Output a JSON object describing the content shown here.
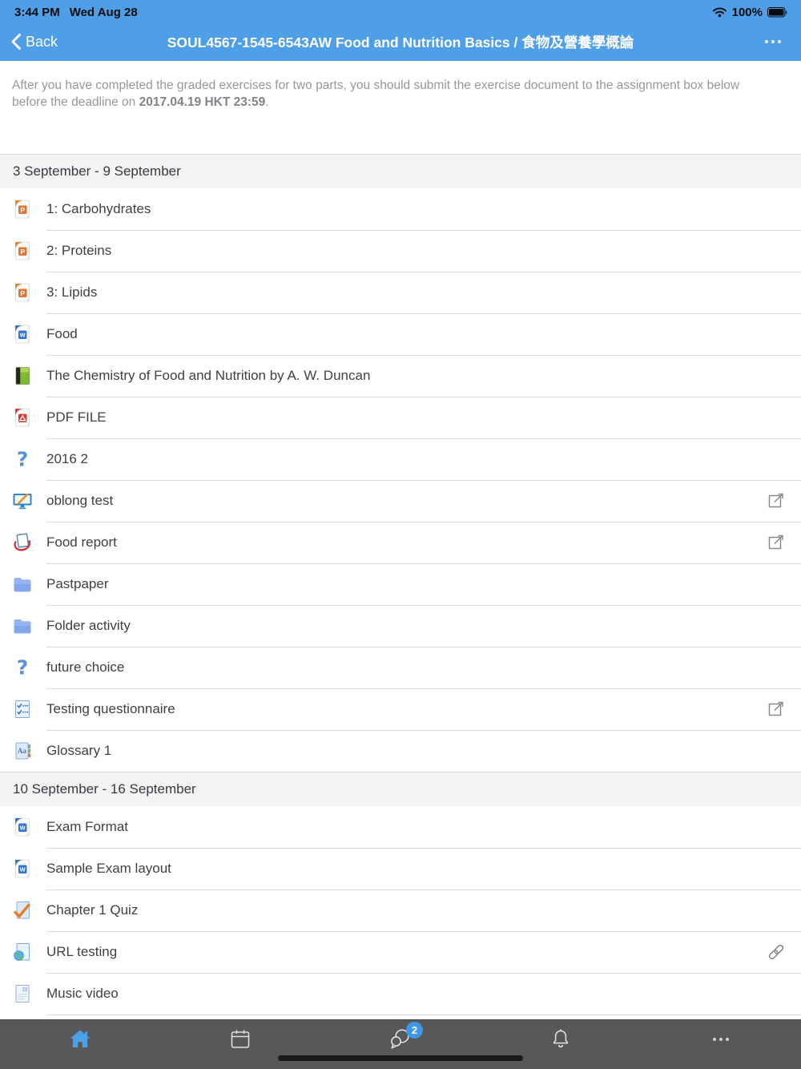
{
  "colors": {
    "header_blue": "#4F9FE8",
    "badge_blue": "#3E97E8",
    "home_tab_blue": "#4AA1E8",
    "tab_bar_gray": "#58585A"
  },
  "status_bar": {
    "time": "3:44 PM",
    "date": "Wed Aug 28",
    "battery_percent": "100%"
  },
  "nav_bar": {
    "back_label": "Back",
    "title": "SOUL4567-1545-6543AW Food and Nutrition Basics / 食物及營養學概論"
  },
  "course_summary": {
    "text_before": "After you have completed the graded exercises for two parts, you should submit the exercise document to the assignment box below before the deadline on ",
    "deadline": "2017.04.19 HKT 23:59",
    "text_after": "."
  },
  "sections": [
    {
      "header": "3 September - 9 September",
      "items": [
        {
          "icon": "powerpoint",
          "label": "1: Carbohydrates"
        },
        {
          "icon": "powerpoint",
          "label": "2: Proteins"
        },
        {
          "icon": "powerpoint",
          "label": "3: Lipids"
        },
        {
          "icon": "word",
          "label": "Food"
        },
        {
          "icon": "book",
          "label": "The Chemistry of Food and Nutrition by A. W. Duncan"
        },
        {
          "icon": "pdf",
          "label": "PDF FILE"
        },
        {
          "icon": "choice",
          "label": "2016 2"
        },
        {
          "icon": "assignment",
          "label": "oblong test",
          "trailing": "external-link"
        },
        {
          "icon": "turnitin",
          "label": "Food report",
          "trailing": "external-link"
        },
        {
          "icon": "folder",
          "label": "Pastpaper"
        },
        {
          "icon": "folder",
          "label": "Folder activity"
        },
        {
          "icon": "choice",
          "label": "future choice"
        },
        {
          "icon": "questionnaire",
          "label": "Testing questionnaire",
          "trailing": "external-link"
        },
        {
          "icon": "glossary",
          "label": "Glossary 1"
        }
      ]
    },
    {
      "header": "10 September - 16 September",
      "items": [
        {
          "icon": "word",
          "label": "Exam Format"
        },
        {
          "icon": "word",
          "label": "Sample Exam layout"
        },
        {
          "icon": "quiz",
          "label": "Chapter 1 Quiz"
        },
        {
          "icon": "url",
          "label": "URL testing",
          "trailing": "link"
        },
        {
          "icon": "page",
          "label": "Music video"
        }
      ]
    }
  ],
  "tab_bar": {
    "tabs": [
      {
        "name": "home",
        "active": true
      },
      {
        "name": "calendar"
      },
      {
        "name": "messages",
        "badge": "2"
      },
      {
        "name": "notifications"
      },
      {
        "name": "more"
      }
    ]
  }
}
